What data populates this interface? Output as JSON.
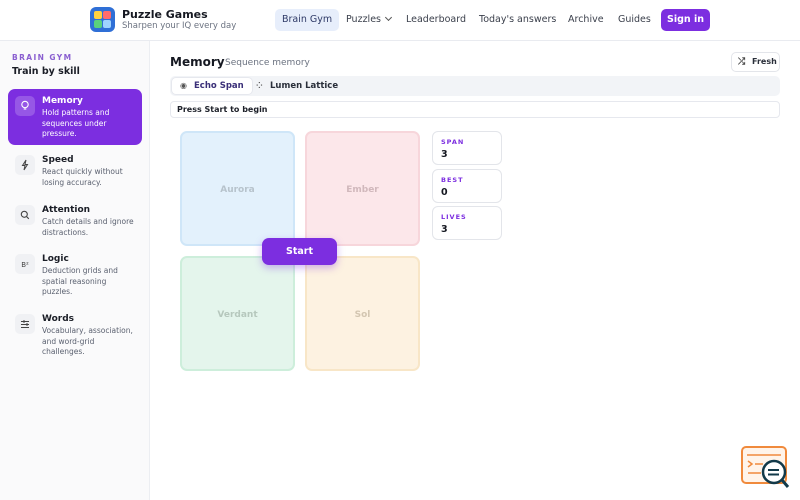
{
  "brand": {
    "title": "Puzzle Games",
    "subtitle": "Sharpen your IQ every day"
  },
  "nav": {
    "items": [
      {
        "label": "Brain Gym",
        "active": true
      },
      {
        "label": "Puzzles",
        "dropdown": true
      },
      {
        "label": "Leaderboard"
      },
      {
        "label": "Today's answers"
      },
      {
        "label": "Archive"
      },
      {
        "label": "Guides"
      }
    ],
    "signin_label": "Sign in"
  },
  "sidebar": {
    "eyebrow": "BRAIN GYM",
    "title": "Train by skill",
    "items": [
      {
        "label": "Memory",
        "desc": "Hold patterns and sequences under pressure.",
        "icon": "lightbulb-icon",
        "active": true
      },
      {
        "label": "Speed",
        "desc": "React quickly without losing accuracy.",
        "icon": "bolt-icon"
      },
      {
        "label": "Attention",
        "desc": "Catch details and ignore distractions.",
        "icon": "search-icon"
      },
      {
        "label": "Logic",
        "desc": "Deduction grids and spatial reasoning puzzles.",
        "icon": "logic-icon"
      },
      {
        "label": "Words",
        "desc": "Vocabulary, association, and word-grid challenges.",
        "icon": "sliders-icon"
      }
    ]
  },
  "main": {
    "title": "Memory",
    "subtitle": "Sequence memory",
    "fresh_label": "Fresh",
    "tabs": [
      {
        "label": "Echo Span",
        "icon": "eye-icon",
        "active": true
      },
      {
        "label": "Lumen Lattice",
        "icon": "lattice-icon"
      }
    ],
    "status": "Press Start to begin",
    "pads": [
      "Aurora",
      "Ember",
      "Verdant",
      "Sol"
    ],
    "start_label": "Start",
    "stats": [
      {
        "label": "SPAN",
        "value": "3"
      },
      {
        "label": "BEST",
        "value": "0"
      },
      {
        "label": "LIVES",
        "value": "3"
      }
    ]
  },
  "colors": {
    "accent": "#7c2ee0",
    "aurora": "#e3f1fc",
    "ember": "#fce7ea",
    "verdant": "#e4f5ec",
    "sol": "#fdf2e1"
  }
}
